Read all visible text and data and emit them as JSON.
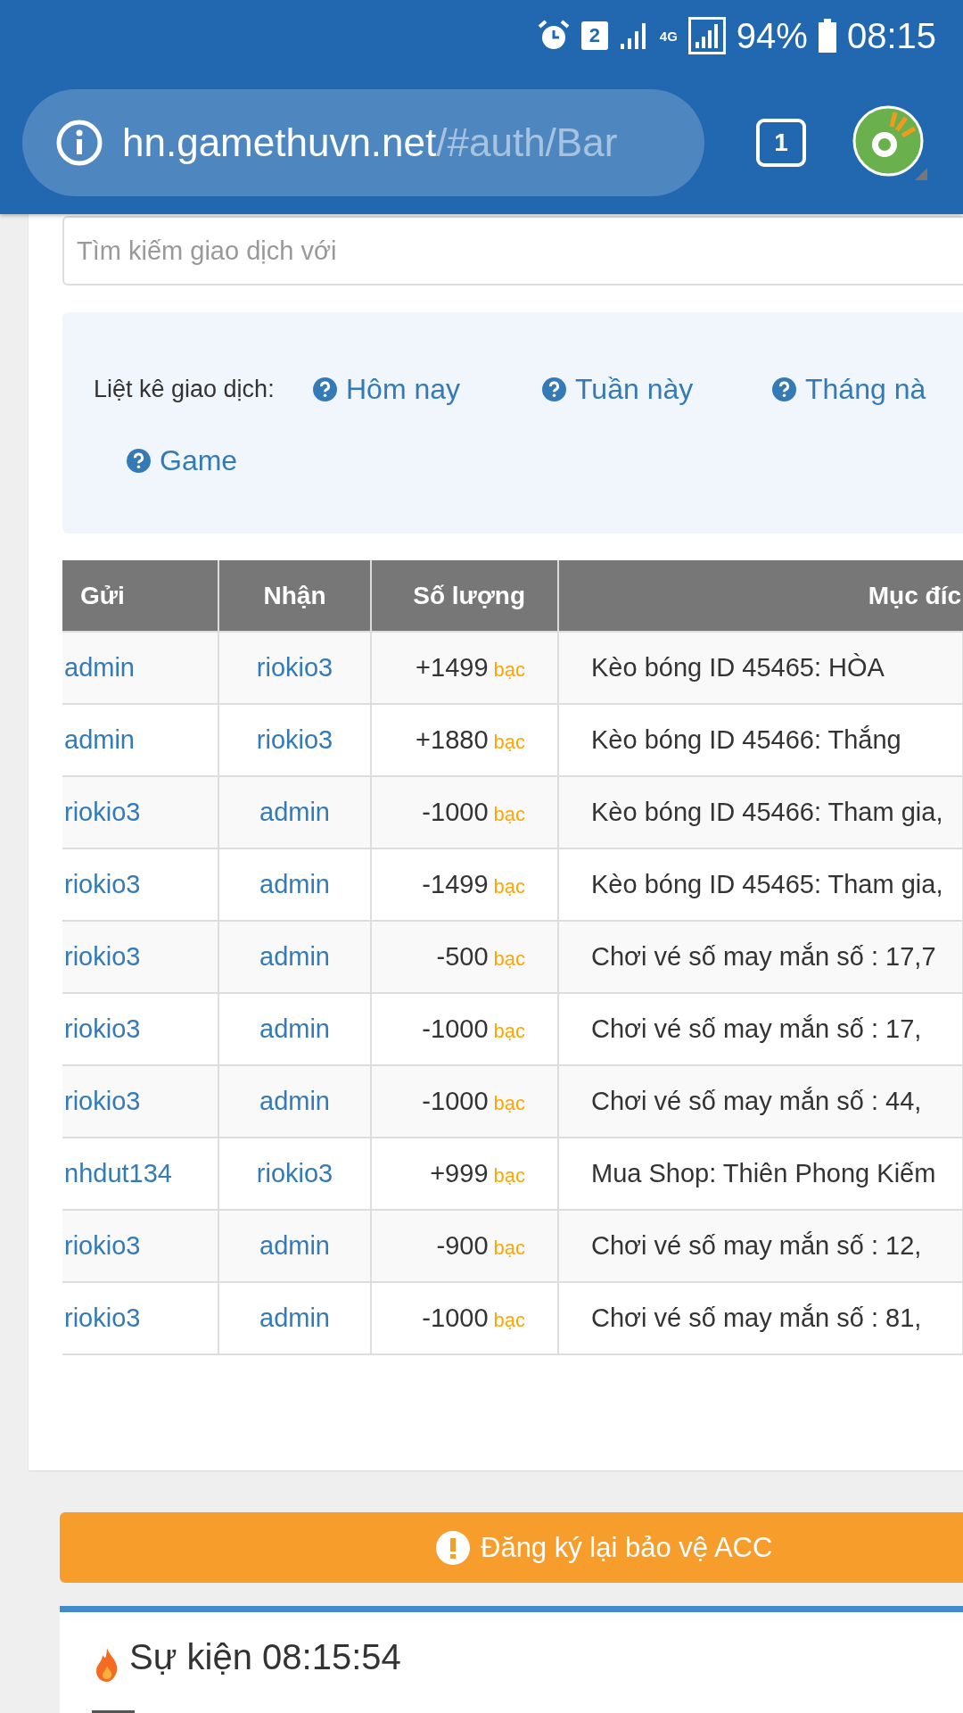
{
  "status_bar": {
    "sim": "2",
    "network": "4G",
    "battery": "94%",
    "time": "08:15"
  },
  "address_bar": {
    "domain": "hn.gamethuvn.net",
    "path": "/#auth/Bar",
    "tab_count": "1"
  },
  "search": {
    "placeholder": "Tìm kiếm giao dịch với"
  },
  "filters": {
    "label": "Liệt kê giao dịch:",
    "links": [
      "Hôm nay",
      "Tuần này",
      "Tháng nà",
      "Game"
    ]
  },
  "table": {
    "columns": [
      "Gửi",
      "Nhận",
      "Số lượng",
      "Mục đíc"
    ],
    "rows": [
      {
        "sender": "admin",
        "receiver": "riokio3",
        "amount": "+1499",
        "unit": "bạc",
        "purpose": "Kèo bóng ID 45465: HÒA"
      },
      {
        "sender": "admin",
        "receiver": "riokio3",
        "amount": "+1880",
        "unit": "bạc",
        "purpose": "Kèo bóng ID 45466: Thắng"
      },
      {
        "sender": "riokio3",
        "receiver": "admin",
        "amount": "-1000",
        "unit": "bạc",
        "purpose": "Kèo bóng ID 45466: Tham gia,"
      },
      {
        "sender": "riokio3",
        "receiver": "admin",
        "amount": "-1499",
        "unit": "bạc",
        "purpose": "Kèo bóng ID 45465: Tham gia,"
      },
      {
        "sender": "riokio3",
        "receiver": "admin",
        "amount": "-500",
        "unit": "bạc",
        "purpose": "Chơi vé số may mắn số : 17,7"
      },
      {
        "sender": "riokio3",
        "receiver": "admin",
        "amount": "-1000",
        "unit": "bạc",
        "purpose": "Chơi vé số may mắn số : 17,"
      },
      {
        "sender": "riokio3",
        "receiver": "admin",
        "amount": "-1000",
        "unit": "bạc",
        "purpose": "Chơi vé số may mắn số : 44,"
      },
      {
        "sender": "nhdut134",
        "receiver": "riokio3",
        "amount": "+999",
        "unit": "bạc",
        "purpose": "Mua Shop: Thiên Phong Kiếm"
      },
      {
        "sender": "riokio3",
        "receiver": "admin",
        "amount": "-900",
        "unit": "bạc",
        "purpose": "Chơi vé số may mắn số : 12,"
      },
      {
        "sender": "riokio3",
        "receiver": "admin",
        "amount": "-1000",
        "unit": "bạc",
        "purpose": "Chơi vé số may mắn số : 81,"
      }
    ]
  },
  "protect_button": {
    "label": "Đăng ký lại bảo vệ ACC"
  },
  "event": {
    "title": "Sự kiện 08:15:54"
  }
}
